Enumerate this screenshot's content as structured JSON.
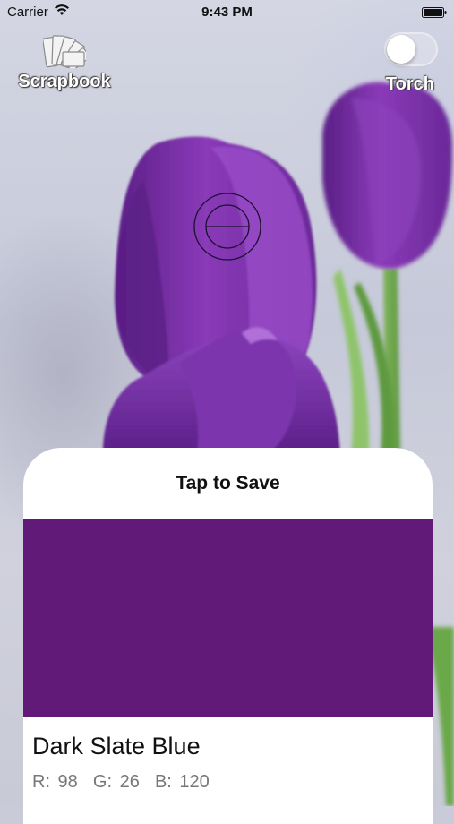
{
  "status_bar": {
    "carrier": "Carrier",
    "time": "9:43 PM"
  },
  "header": {
    "scrapbook_label": "Scrapbook",
    "torch_label": "Torch",
    "torch_on": false
  },
  "icons": {
    "scrapbook": "fan-deck-icon",
    "reticle": "crosshair-icon",
    "wifi": "wifi-icon",
    "battery": "battery-icon"
  },
  "card": {
    "title": "Tap to Save",
    "color_name": "Dark Slate Blue",
    "rgb_text": "R: 98  G: 26  B: 120",
    "swatch_color": "#621A78"
  },
  "colors": {
    "tulip_purple": "#7a2aa0",
    "stem_green": "#6ea64a"
  }
}
